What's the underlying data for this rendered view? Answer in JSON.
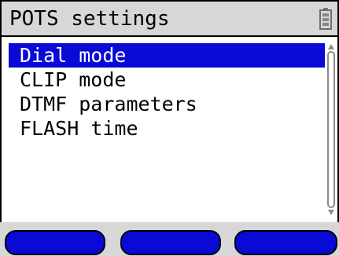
{
  "header": {
    "title": "POTS settings",
    "status_icon": "battery-icon"
  },
  "menu": {
    "items": [
      {
        "label": "Dial mode",
        "selected": true
      },
      {
        "label": "CLIP mode",
        "selected": false
      },
      {
        "label": "DTMF parameters",
        "selected": false
      },
      {
        "label": "FLASH time",
        "selected": false
      }
    ]
  },
  "softkeys": {
    "count": 3,
    "labels": [
      "",
      "",
      ""
    ]
  },
  "colors": {
    "accent": "#0a0ad6",
    "chrome": "#d7d7d7",
    "background": "#ffffff",
    "frame": "#000000"
  }
}
